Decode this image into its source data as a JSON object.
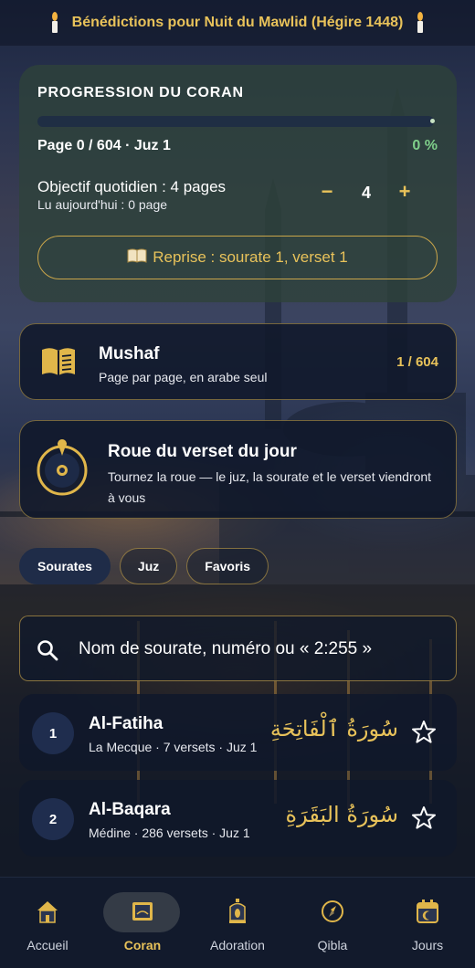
{
  "banner": {
    "text": "Bénédictions pour Nuit du Mawlid (Hégire 1448)"
  },
  "progress": {
    "title": "PROGRESSION DU CORAN",
    "fraction": 0,
    "page_text": "Page 0 / 604 · Juz 1",
    "percent_text": "0 %",
    "goal_text": "Objectif quotidien : 4 pages",
    "read_today_text": "Lu aujourd'hui : 0 page",
    "stepper": {
      "minus": "−",
      "value": "4",
      "plus": "+"
    },
    "resume_text": "Reprise : sourate 1, verset 1"
  },
  "mushaf": {
    "title": "Mushaf",
    "subtitle": "Page par page, en arabe seul",
    "count": "1 / 604"
  },
  "wheel": {
    "title": "Roue du verset du jour",
    "subtitle": "Tournez la roue — le juz, la sourate et le verset viendront à vous"
  },
  "tabs": [
    {
      "label": "Sourates",
      "active": true
    },
    {
      "label": "Juz",
      "active": false
    },
    {
      "label": "Favoris",
      "active": false
    }
  ],
  "search": {
    "placeholder": "Nom de sourate, numéro ou « 2:255 »"
  },
  "surahs": [
    {
      "number": "1",
      "name": "Al-Fatiha",
      "meta": "La Mecque · 7 versets · Juz 1",
      "arabic": "سُورَةُ ٱلْفَاتِحَةِ"
    },
    {
      "number": "2",
      "name": "Al-Baqara",
      "meta": "Médine · 286 versets · Juz 1",
      "arabic": "سُورَةُ البَقَرَةِ"
    }
  ],
  "nav": [
    {
      "label": "Accueil",
      "icon": "home-icon",
      "active": false
    },
    {
      "label": "Coran",
      "icon": "quran-icon",
      "active": true
    },
    {
      "label": "Adoration",
      "icon": "lantern-icon",
      "active": false
    },
    {
      "label": "Qibla",
      "icon": "compass-icon",
      "active": false
    },
    {
      "label": "Jours",
      "icon": "calendar-icon",
      "active": false
    }
  ],
  "colors": {
    "gold": "#e8c25a",
    "green": "#7fcf8a",
    "card": "#10182a",
    "nav": "#121a2c"
  }
}
